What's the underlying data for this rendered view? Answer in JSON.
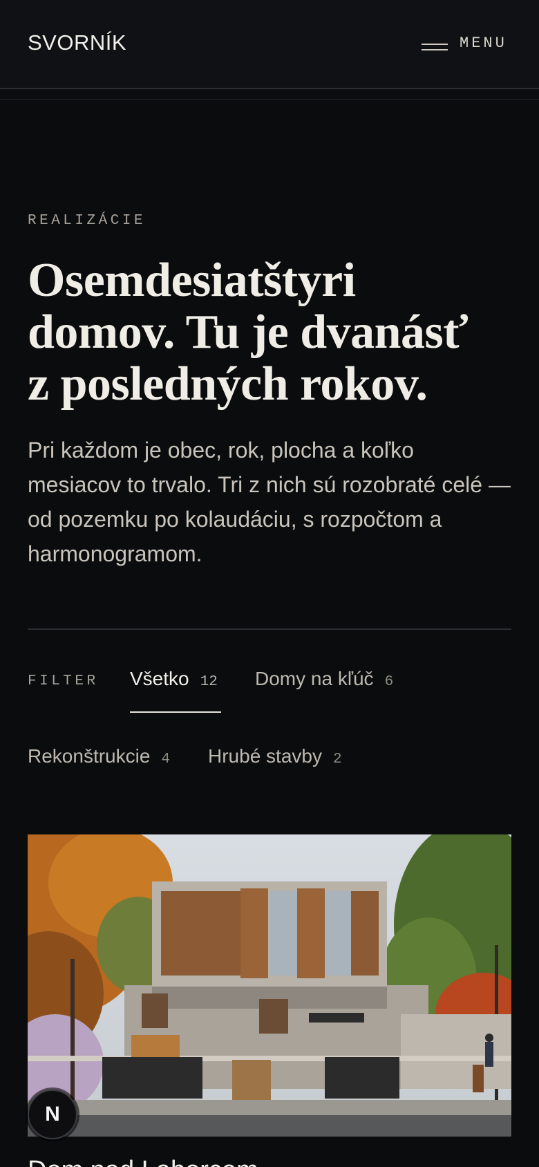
{
  "header": {
    "logo": "SVORNÍK",
    "menu_label": "MENU"
  },
  "intro": {
    "eyebrow": "REALIZÁCIE",
    "headline_lines": [
      "Osemdesiatštyri",
      "domov. Tu je dvanásť",
      "z posledných rokov."
    ],
    "lead": "Pri každom je obec, rok, plocha a koľko mesiacov to trvalo. Tri z nich sú rozobraté celé — od pozemku po kolaudáciu, s rozpočtom a harmonogramom."
  },
  "filter": {
    "label": "FILTER",
    "options": [
      {
        "label": "Všetko",
        "count": "12",
        "active": true
      },
      {
        "label": "Domy na kľúč",
        "count": "6",
        "active": false
      },
      {
        "label": "Rekonštrukcie",
        "count": "4",
        "active": false
      },
      {
        "label": "Hrubé stavby",
        "count": "2",
        "active": false
      }
    ]
  },
  "card": {
    "image_alt": "modern-house-photo",
    "title": "Dom nad Laborcom"
  },
  "badge": {
    "letter": "N"
  },
  "colors": {
    "background": "#0b0c0e",
    "text": "#e9e6df",
    "muted": "#a7a39a"
  }
}
